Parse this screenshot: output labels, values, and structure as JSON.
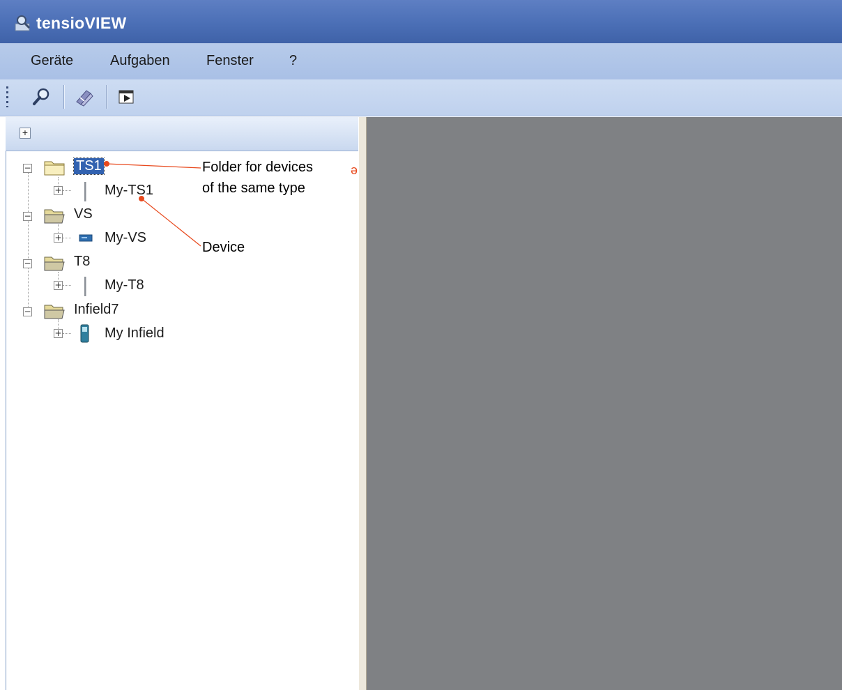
{
  "window": {
    "title": "tensioVIEW",
    "icon": "magnifier-app-icon"
  },
  "menu": {
    "items": [
      "Geräte",
      "Aufgaben",
      "Fenster",
      "?"
    ]
  },
  "toolbar": {
    "buttons": [
      {
        "icon": "search-icon"
      },
      {
        "icon": "tools-icon"
      },
      {
        "icon": "window-arrow-icon"
      }
    ]
  },
  "tree": {
    "expand_all_label": "+",
    "nodes": [
      {
        "folder": "TS1",
        "selected": true,
        "child": "My-TS1",
        "child_icon": "probe-device-icon"
      },
      {
        "folder": "VS",
        "selected": false,
        "child": "My-VS",
        "child_icon": "logger-device-icon"
      },
      {
        "folder": "T8",
        "selected": false,
        "child": "My-T8",
        "child_icon": "probe-device-icon"
      },
      {
        "folder": "Infield7",
        "selected": false,
        "child": "My Infield",
        "child_icon": "handheld-device-icon"
      }
    ]
  },
  "annotations": {
    "folder_note_line1": "Folder for devices",
    "folder_note_line2": "of the same type",
    "device_note": "Device",
    "color": "#e8491d"
  }
}
